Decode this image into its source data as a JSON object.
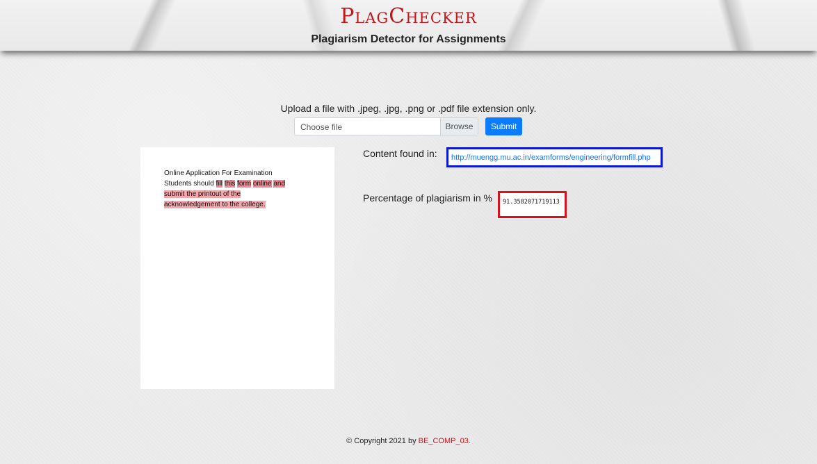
{
  "header": {
    "brand": "PlagChecker",
    "subtitle": "Plagiarism Detector for Assignments"
  },
  "upload": {
    "instruction": "Upload a file with .jpeg, .jpg, .png or .pdf file extension only.",
    "file_placeholder": "Choose file",
    "browse_label": "Browse",
    "submit_label": "Submit"
  },
  "preview": {
    "line1": "Online Application For Examination",
    "line2_plain": "Students should",
    "line2_hl": [
      "fill",
      "this",
      "form",
      "online",
      "and"
    ],
    "line3": "submit the printout of the",
    "line4": "acknowledgement to the college."
  },
  "results": {
    "content_found_label": "Content found in:",
    "source_url": "http://muengg.mu.ac.in/examforms/engineering/formfill.php",
    "percentage_label": "Percentage of plagiarism in %",
    "percentage_value": "91.3582071719113"
  },
  "footer": {
    "copyright": "© Copyright 2021 by",
    "team": "BE_COMP_03."
  },
  "colors": {
    "brand": "#c0181b",
    "url_border": "#0a16d6",
    "percentage_border": "#d4131b",
    "highlight": "#f3a7ad",
    "submit": "#0d7bfd"
  }
}
